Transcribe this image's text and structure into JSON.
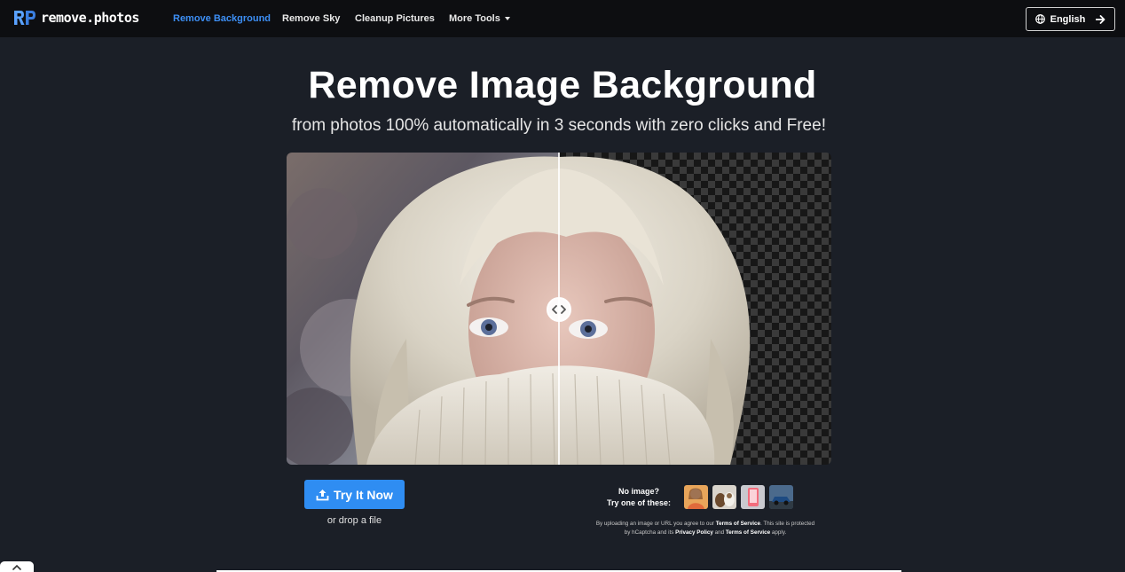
{
  "nav": {
    "logo_text": "remove.photos",
    "links": [
      {
        "label": "Remove Background",
        "active": true
      },
      {
        "label": "Remove Sky",
        "active": false
      },
      {
        "label": "Cleanup Pictures",
        "active": false
      },
      {
        "label": "More Tools",
        "active": false
      }
    ],
    "language_label": "English"
  },
  "hero": {
    "title": "Remove Image Background",
    "subtitle": "from photos 100% automatically in 3 seconds with zero clicks and Free!"
  },
  "upload": {
    "button_label": "Try It Now",
    "drop_text": "or drop a file"
  },
  "samples": {
    "prompt_line1": "No image?",
    "prompt_line2": "Try one of these:"
  },
  "legal": {
    "part1": "By uploading an image or URL you agree to our ",
    "terms": "Terms of Service",
    "part2": ". This site is protected by hCaptcha and its ",
    "privacy": "Privacy Policy",
    "part3": " and ",
    "terms2": "Terms of Service",
    "part4": " apply."
  },
  "colors": {
    "accent": "#2f8df2",
    "nav_active": "#3d8ff5",
    "background": "#1b1f27",
    "nav_background": "#0d0e11"
  },
  "icons": [
    "globe-icon",
    "arrow-right-icon",
    "chevron-down-icon",
    "compare-handle-icon",
    "upload-icon",
    "chevron-up-icon"
  ]
}
